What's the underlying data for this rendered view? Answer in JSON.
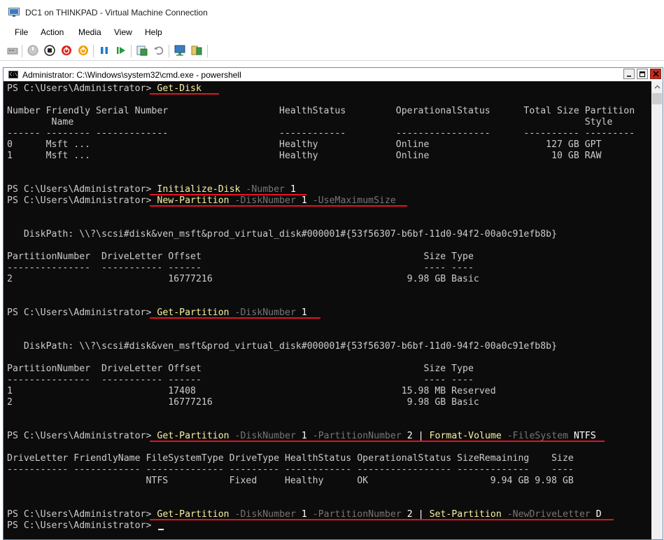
{
  "window": {
    "title": "DC1 on THINKPAD - Virtual Machine Connection",
    "menu": [
      "File",
      "Action",
      "Media",
      "View",
      "Help"
    ],
    "toolbar_icons": [
      "ctrl-alt-del-icon",
      "start-icon",
      "turn-off-icon",
      "shut-down-icon",
      "save-icon",
      "pause-icon",
      "resume-icon",
      "checkpoint-icon",
      "revert-icon",
      "enhanced-session-icon",
      "share-icon"
    ]
  },
  "console": {
    "title": "Administrator: C:\\Windows\\system32\\cmd.exe - powershell",
    "prompt": "PS C:\\Users\\Administrator> ",
    "cmd1": {
      "cmd": "Get-Disk"
    },
    "disk_table": {
      "header1": "Number Friendly Serial Number                    HealthStatus         OperationalStatus      Total Size Partition",
      "header2": "        Name                                                                                            Style",
      "divider": "------ -------- -------------                    ------------         -----------------      ---------- ---------",
      "row1": "0      Msft ...                                  Healthy              Online                     127 GB GPT",
      "row2": "1      Msft ...                                  Healthy              Online                      10 GB RAW"
    },
    "cmd2": {
      "cmd": "Initialize-Disk",
      "p1": "-Number",
      "v1": "1"
    },
    "cmd3": {
      "cmd": "New-Partition",
      "p1": "-DiskNumber",
      "v1": "1",
      "p2": "-UseMaximumSize"
    },
    "diskpath": "   DiskPath: \\\\?\\scsi#disk&ven_msft&prod_virtual_disk#000001#{53f56307-b6bf-11d0-94f2-00a0c91efb8b}",
    "part_table1": {
      "header": "PartitionNumber  DriveLetter Offset                                        Size Type",
      "divider": "---------------  ----------- ------                                        ---- ----",
      "row1": "2                            16777216                                   9.98 GB Basic"
    },
    "cmd4": {
      "cmd": "Get-Partition",
      "p1": "-DiskNumber",
      "v1": "1"
    },
    "part_table2": {
      "header": "PartitionNumber  DriveLetter Offset                                        Size Type",
      "divider": "---------------  ----------- ------                                        ---- ----",
      "row1": "1                            17408                                     15.98 MB Reserved",
      "row2": "2                            16777216                                   9.98 GB Basic"
    },
    "cmd5": {
      "cmd": "Get-Partition",
      "p1": "-DiskNumber",
      "v1": "1",
      "p2": "-PartitionNumber",
      "v2": "2",
      "pipe": "|",
      "cmd_b": "Format-Volume",
      "p3": "-FileSystem",
      "v3": "NTFS"
    },
    "vol_table": {
      "header": "DriveLetter FriendlyName FileSystemType DriveType HealthStatus OperationalStatus SizeRemaining    Size",
      "divider": "----------- ------------ -------------- --------- ------------ ----------------- -------------    ----",
      "row1": "                         NTFS           Fixed     Healthy      OK                      9.94 GB 9.98 GB"
    },
    "cmd6": {
      "cmd": "Get-Partition",
      "p1": "-DiskNumber",
      "v1": "1",
      "p2": "-PartitionNumber",
      "v2": "2",
      "pipe": "|",
      "cmd_b": "Set-Partition",
      "p3": "-NewDriveLetter",
      "v3": "D"
    }
  },
  "colors": {
    "cmdlet": "#f9f1a5",
    "parameter": "#767676",
    "value": "#ffffff",
    "text": "#cccccc",
    "background": "#0c0c0c",
    "underline": "#e81123"
  }
}
